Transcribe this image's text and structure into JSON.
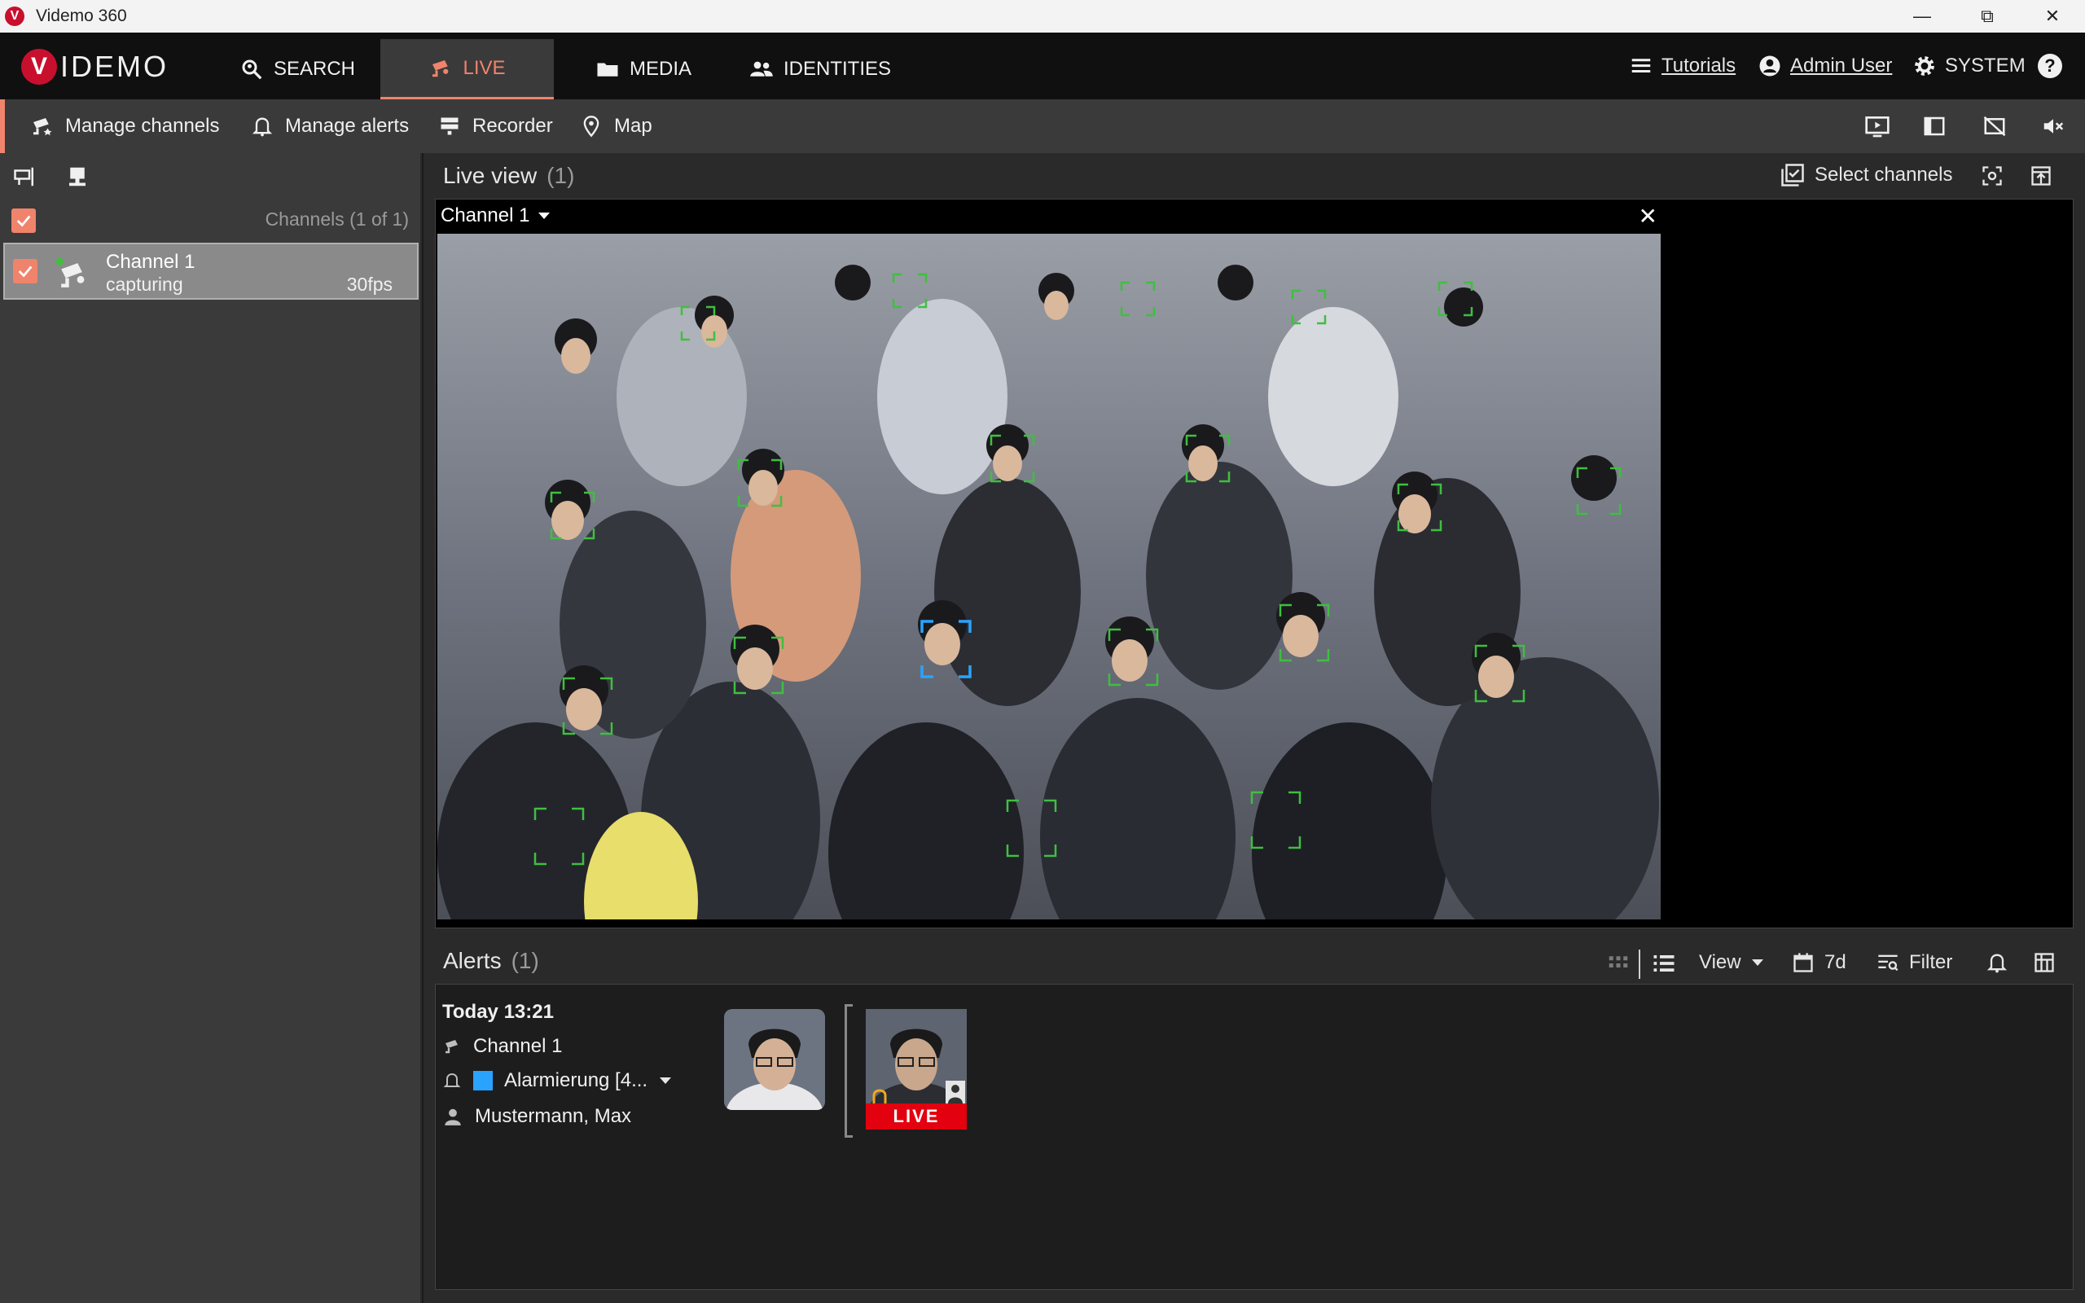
{
  "window": {
    "title": "Videmo 360"
  },
  "nav": {
    "logo_letter": "V",
    "logo_text": "IDEMO",
    "tabs": [
      {
        "label": "SEARCH",
        "icon": "search-person-icon"
      },
      {
        "label": "LIVE",
        "icon": "camera-icon",
        "active": true
      },
      {
        "label": "MEDIA",
        "icon": "folder-icon"
      },
      {
        "label": "IDENTITIES",
        "icon": "people-icon"
      }
    ],
    "tutorials": "Tutorials",
    "user": "Admin User",
    "system": "SYSTEM",
    "help": "?"
  },
  "toolbar": {
    "items": [
      {
        "label": "Manage channels",
        "icon": "camera-icon"
      },
      {
        "label": "Manage alerts",
        "icon": "bell-icon"
      },
      {
        "label": "Recorder",
        "icon": "server-icon"
      },
      {
        "label": "Map",
        "icon": "pin-icon"
      }
    ]
  },
  "sidebar": {
    "channels_count": "Channels (1 of 1)",
    "channel": {
      "name": "Channel 1",
      "status": "capturing",
      "fps": "30fps"
    }
  },
  "live": {
    "title": "Live view",
    "count": "(1)",
    "select_channels": "Select channels",
    "channel_label": "Channel 1",
    "close": "✕"
  },
  "alerts": {
    "title": "Alerts",
    "count": "(1)",
    "view": "View",
    "range": "7d",
    "filter": "Filter",
    "item": {
      "time": "Today 13:21",
      "channel": "Channel 1",
      "alert_name": "Alarmierung [4...",
      "person": "Mustermann, Max",
      "badge": "LIVE"
    }
  },
  "colors": {
    "accent": "#f0836c",
    "brand": "#c8102e",
    "live": "#e3000f",
    "detect": "#3fbf3f",
    "match": "#2aa3ff"
  }
}
